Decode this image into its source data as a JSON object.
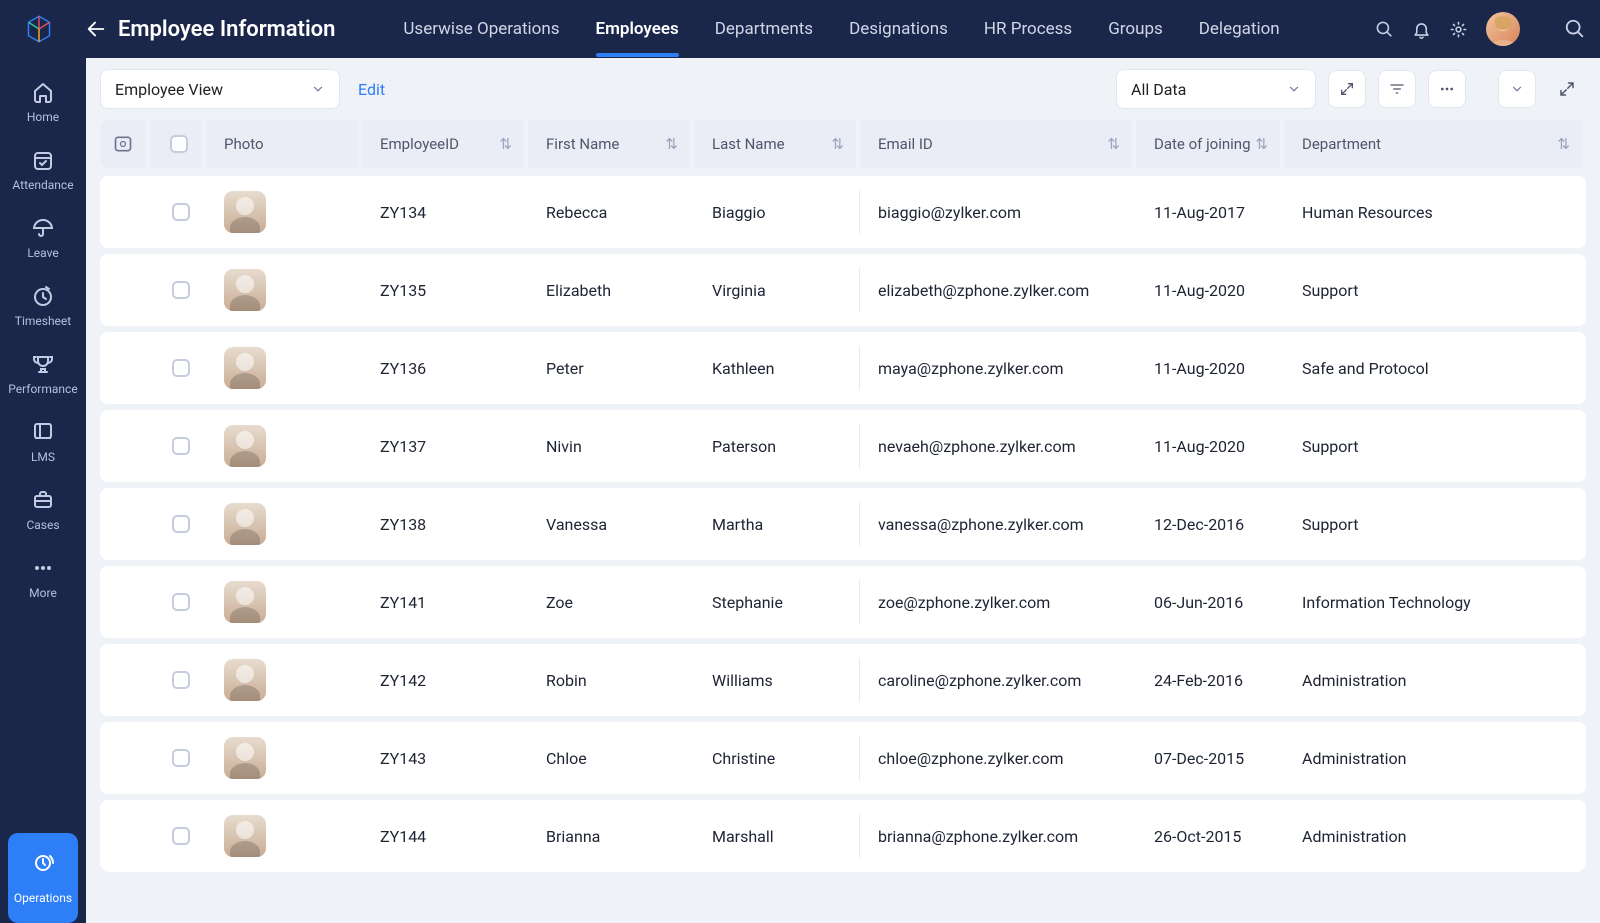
{
  "header": {
    "title": "Employee Information",
    "tabs": [
      {
        "label": "Userwise Operations",
        "active": false
      },
      {
        "label": "Employees",
        "active": true
      },
      {
        "label": "Departments",
        "active": false
      },
      {
        "label": "Designations",
        "active": false
      },
      {
        "label": "HR Process",
        "active": false
      },
      {
        "label": "Groups",
        "active": false
      },
      {
        "label": "Delegation",
        "active": false
      }
    ]
  },
  "sidebar": {
    "items": [
      {
        "label": "Home",
        "icon": "home-icon"
      },
      {
        "label": "Attendance",
        "icon": "calendar-check-icon"
      },
      {
        "label": "Leave",
        "icon": "umbrella-icon"
      },
      {
        "label": "Timesheet",
        "icon": "clock-icon"
      },
      {
        "label": "Performance",
        "icon": "trophy-icon"
      },
      {
        "label": "LMS",
        "icon": "book-icon"
      },
      {
        "label": "Cases",
        "icon": "briefcase-icon"
      },
      {
        "label": "More",
        "icon": "dots-icon"
      }
    ],
    "bottom": {
      "label": "Operations",
      "icon": "gear-rotate-icon"
    }
  },
  "toolbar": {
    "view_selector": "Employee View",
    "edit_label": "Edit",
    "data_filter": "All Data"
  },
  "table": {
    "columns": [
      {
        "key": "photo",
        "label": "Photo"
      },
      {
        "key": "employee_id",
        "label": "EmployeeID"
      },
      {
        "key": "first_name",
        "label": "First Name"
      },
      {
        "key": "last_name",
        "label": "Last Name"
      },
      {
        "key": "email",
        "label": "Email ID"
      },
      {
        "key": "doj",
        "label": "Date of joining"
      },
      {
        "key": "department",
        "label": "Department"
      }
    ],
    "rows": [
      {
        "employee_id": "ZY134",
        "first_name": "Rebecca",
        "last_name": "Biaggio",
        "email": "biaggio@zylker.com",
        "doj": "11-Aug-2017",
        "department": "Human Resources"
      },
      {
        "employee_id": "ZY135",
        "first_name": "Elizabeth",
        "last_name": "Virginia",
        "email": "elizabeth@zphone.zylker.com",
        "doj": "11-Aug-2020",
        "department": "Support"
      },
      {
        "employee_id": "ZY136",
        "first_name": "Peter",
        "last_name": "Kathleen",
        "email": "maya@zphone.zylker.com",
        "doj": "11-Aug-2020",
        "department": "Safe and Protocol"
      },
      {
        "employee_id": "ZY137",
        "first_name": "Nivin",
        "last_name": "Paterson",
        "email": "nevaeh@zphone.zylker.com",
        "doj": "11-Aug-2020",
        "department": "Support"
      },
      {
        "employee_id": "ZY138",
        "first_name": "Vanessa",
        "last_name": "Martha",
        "email": "vanessa@zphone.zylker.com",
        "doj": "12-Dec-2016",
        "department": "Support"
      },
      {
        "employee_id": "ZY141",
        "first_name": "Zoe",
        "last_name": "Stephanie",
        "email": "zoe@zphone.zylker.com",
        "doj": "06-Jun-2016",
        "department": "Information Technology"
      },
      {
        "employee_id": "ZY142",
        "first_name": "Robin",
        "last_name": "Williams",
        "email": "caroline@zphone.zylker.com",
        "doj": "24-Feb-2016",
        "department": "Administration"
      },
      {
        "employee_id": "ZY143",
        "first_name": "Chloe",
        "last_name": "Christine",
        "email": "chloe@zphone.zylker.com",
        "doj": "07-Dec-2015",
        "department": "Administration"
      },
      {
        "employee_id": "ZY144",
        "first_name": "Brianna",
        "last_name": "Marshall",
        "email": "brianna@zphone.zylker.com",
        "doj": "26-Oct-2015",
        "department": "Administration"
      }
    ]
  }
}
